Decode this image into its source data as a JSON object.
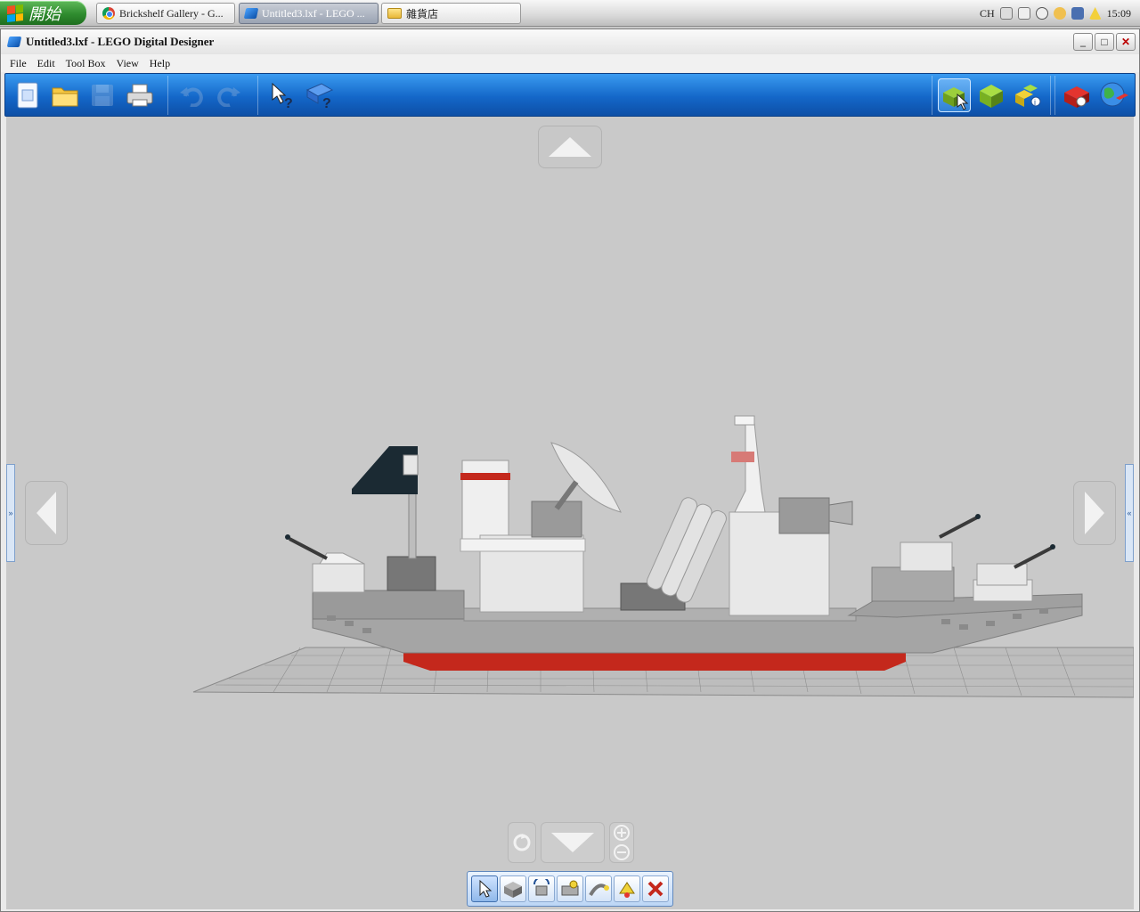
{
  "taskbar": {
    "start_label": "開始",
    "tasks": [
      {
        "label": "Brickshelf Gallery - G...",
        "icon": "chrome-icon"
      },
      {
        "label": "Untitled3.lxf - LEGO ...",
        "icon": "lego-digital-designer-icon",
        "active": true
      },
      {
        "label": "雜貨店",
        "icon": "folder-icon"
      }
    ],
    "tray": {
      "lang": "CH",
      "time": "15:09"
    }
  },
  "window": {
    "title": "Untitled3.lxf - LEGO Digital Designer",
    "controls": [
      "minimize",
      "maximize",
      "close"
    ]
  },
  "menu": [
    {
      "label": "File",
      "accel": "F"
    },
    {
      "label": "Edit",
      "accel": "E"
    },
    {
      "label": "Tool Box",
      "accel": "T"
    },
    {
      "label": "View",
      "accel": "V"
    },
    {
      "label": "Help",
      "accel": "H"
    }
  ],
  "toolbar": {
    "file_buttons": [
      "new-icon",
      "open-icon",
      "save-icon",
      "print-icon"
    ],
    "history_buttons": [
      "undo-icon",
      "redo-icon"
    ],
    "help_buttons": [
      "help-pointer-icon",
      "help-book-icon"
    ],
    "mode_buttons": [
      "build-mode-icon",
      "view-mode-icon",
      "building-guide-icon"
    ],
    "share_buttons": [
      "lego-brick-export-icon",
      "online-gallery-icon"
    ]
  },
  "palette": [
    "select-tool-icon",
    "clone-tool-icon",
    "hinge-tool-icon",
    "hinge-align-tool-icon",
    "flex-tool-icon",
    "paint-tool-icon",
    "delete-tool-icon"
  ],
  "colors": {
    "toolbar_blue": "#1467c9",
    "model_grey": "#a5a5a5",
    "hull_red": "#c4281c",
    "flag_dark": "#1b2a33"
  }
}
